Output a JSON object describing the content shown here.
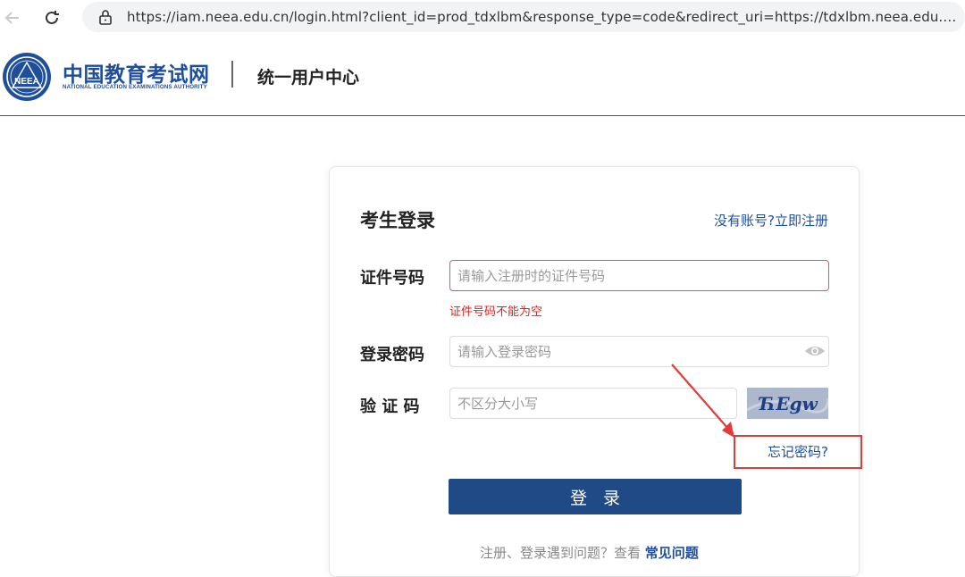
{
  "browser": {
    "url": "https://iam.neea.edu.cn/login.html?client_id=prod_tdxlbm&response_type=code&redirect_uri=https://tdxlbm.neea.edu.cn/user/log..."
  },
  "header": {
    "logo_cn": "中国教育考试网",
    "logo_en": "NATIONAL EDUCATION EXAMINATIONS AUTHORITY",
    "logo_emblem_text": "NEEA",
    "subtitle": "统一用户中心"
  },
  "login": {
    "title": "考生登录",
    "register_link": "没有账号?立即注册",
    "id_label": "证件号码",
    "id_placeholder": "请输入注册时的证件号码",
    "id_error": "证件号码不能为空",
    "password_label": "登录密码",
    "password_placeholder": "请输入登录密码",
    "captcha_label": "验 证 码",
    "captcha_placeholder": "不区分大小写",
    "captcha_text": "ЋEgw",
    "forgot_link": "忘记密码?",
    "submit_label": "登录",
    "help_text": "注册、登录遇到问题？查看 ",
    "faq_link": "常见问题"
  },
  "colors": {
    "brand": "#1f4e9b",
    "button": "#1f4a86",
    "error": "#e02020",
    "annotation": "#e23a3a"
  }
}
